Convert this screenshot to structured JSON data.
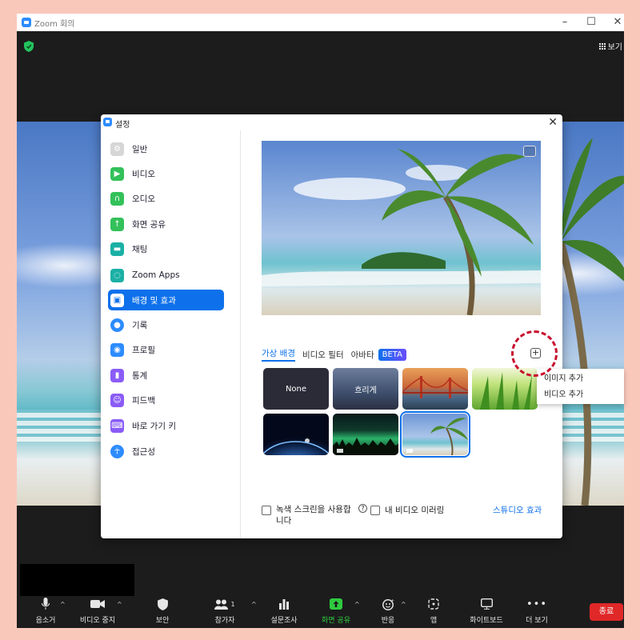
{
  "window": {
    "title": "Zoom 회의",
    "minimize": "–",
    "maximize": "☐",
    "close": "✕"
  },
  "view_button": {
    "label": "보기"
  },
  "toolbar": {
    "items": [
      {
        "label": "음소거"
      },
      {
        "label": "비디오 중지"
      },
      {
        "label": "보안"
      },
      {
        "label": "참가자",
        "count": "1"
      },
      {
        "label": "설문조사"
      },
      {
        "label": "화면 공유"
      },
      {
        "label": "반응"
      },
      {
        "label": "앱"
      },
      {
        "label": "화이트보드"
      },
      {
        "label": "더 보기"
      }
    ],
    "end_label": "종료",
    "share_color": "#2ecc40",
    "end_color": "#e02828"
  },
  "dialog": {
    "title": "설정",
    "close": "✕",
    "sidebar": [
      {
        "label": "일반",
        "icon": "gear-icon",
        "color": "#cccccc"
      },
      {
        "label": "비디오",
        "icon": "video-camera-icon",
        "color": "#33c15a"
      },
      {
        "label": "오디오",
        "icon": "headphones-icon",
        "color": "#33c15a"
      },
      {
        "label": "화면 공유",
        "icon": "share-screen-icon",
        "color": "#33c15a"
      },
      {
        "label": "채팅",
        "icon": "chat-icon",
        "color": "#1bb0a5"
      },
      {
        "label": "Zoom Apps",
        "icon": "apps-icon",
        "color": "#1bb0a5"
      },
      {
        "label": "배경 및 효과",
        "icon": "background-icon",
        "color": "#ffffff",
        "active": true
      },
      {
        "label": "기록",
        "icon": "record-icon",
        "color": "#2d8cff"
      },
      {
        "label": "프로필",
        "icon": "profile-icon",
        "color": "#2d8cff"
      },
      {
        "label": "통계",
        "icon": "statistics-icon",
        "color": "#8a5cf6"
      },
      {
        "label": "피드백",
        "icon": "feedback-icon",
        "color": "#8a5cf6"
      },
      {
        "label": "바로 가기 키",
        "icon": "keyboard-icon",
        "color": "#8a5cf6"
      },
      {
        "label": "접근성",
        "icon": "accessibility-icon",
        "color": "#2d8cff"
      }
    ],
    "tabs": [
      {
        "label": "가상 배경",
        "active": true
      },
      {
        "label": "비디오 필터"
      },
      {
        "label": "아바타"
      }
    ],
    "beta_label": "BETA",
    "add_label": "+",
    "thumbnails": [
      {
        "label": "None",
        "kind": "none"
      },
      {
        "label": "흐리게",
        "kind": "blur"
      },
      {
        "label": "",
        "kind": "golden-gate"
      },
      {
        "label": "",
        "kind": "grass"
      },
      {
        "label": "",
        "kind": "earth"
      },
      {
        "label": "",
        "kind": "aurora"
      },
      {
        "label": "",
        "kind": "beach",
        "selected": true
      }
    ],
    "green_screen_label": "녹색 스크린을 사용합니다",
    "mirror_label": "내 비디오 미러링",
    "studio_effects_label": "스튜디오 효과"
  },
  "context_menu": {
    "items": [
      {
        "label": "이미지 추가"
      },
      {
        "label": "비디오 추가"
      }
    ]
  }
}
